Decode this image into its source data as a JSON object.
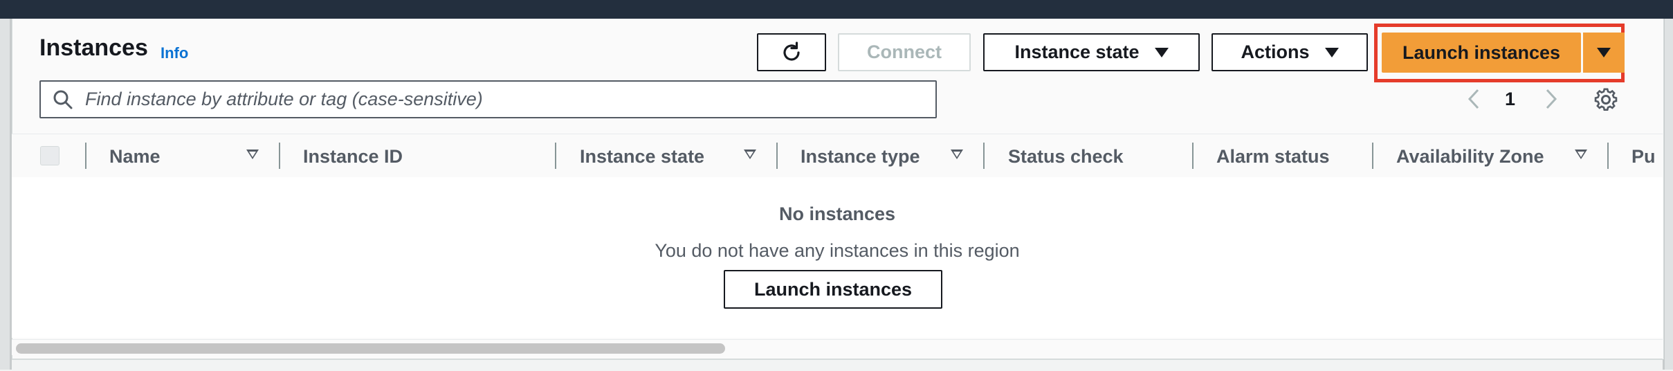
{
  "header": {
    "title": "Instances",
    "info_link": "Info"
  },
  "toolbar": {
    "refresh_icon": "refresh-icon",
    "connect_label": "Connect",
    "instance_state_label": "Instance state",
    "actions_label": "Actions",
    "launch_label": "Launch instances"
  },
  "search": {
    "placeholder": "Find instance by attribute or tag (case-sensitive)",
    "value": ""
  },
  "pagination": {
    "current_page": "1"
  },
  "table": {
    "columns": [
      {
        "label": "Name",
        "filter": true
      },
      {
        "label": "Instance ID",
        "filter": false
      },
      {
        "label": "Instance state",
        "filter": true
      },
      {
        "label": "Instance type",
        "filter": true
      },
      {
        "label": "Status check",
        "filter": false
      },
      {
        "label": "Alarm status",
        "filter": false
      },
      {
        "label": "Availability Zone",
        "filter": true
      },
      {
        "label": "Pu",
        "filter": false
      }
    ],
    "empty": {
      "title": "No instances",
      "subtitle": "You do not have any instances in this region",
      "button_label": "Launch instances"
    }
  },
  "colors": {
    "primary_orange": "#f29d38",
    "highlight_red": "#e53b2a",
    "link_blue": "#0972d3",
    "top_bar": "#232f3e"
  }
}
